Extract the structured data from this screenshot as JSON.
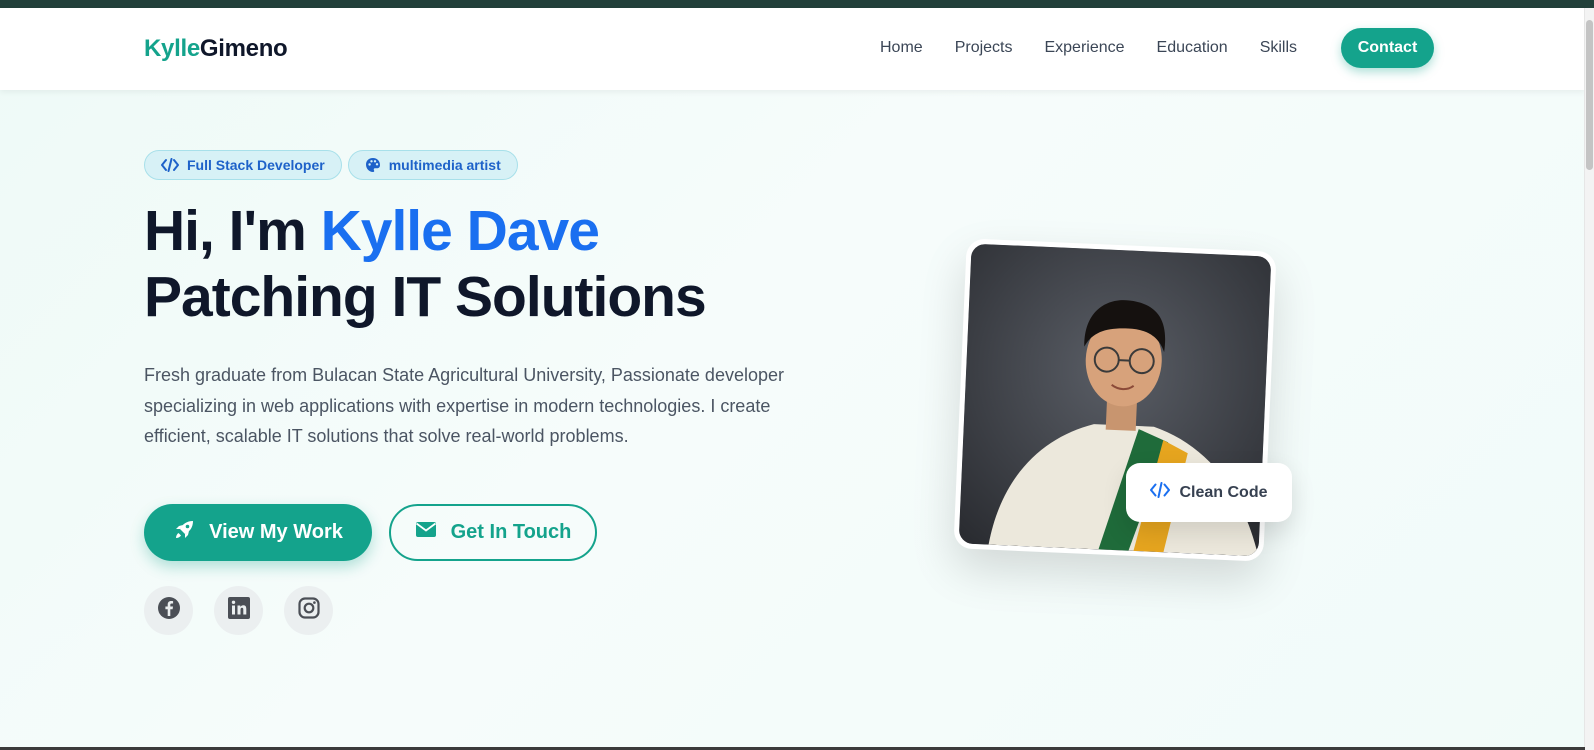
{
  "brand": {
    "first": "Kylle",
    "last": "Gimeno"
  },
  "nav": {
    "links": [
      "Home",
      "Projects",
      "Experience",
      "Education",
      "Skills"
    ],
    "contact_label": "Contact"
  },
  "hero": {
    "badges": [
      {
        "label": "Full Stack Developer",
        "icon": "code-icon"
      },
      {
        "label": "multimedia artist",
        "icon": "palette-icon"
      }
    ],
    "greeting": "Hi, I'm ",
    "name": "Kylle Dave",
    "title_line2": "Patching IT Solutions",
    "description": "Fresh graduate from Bulacan State Agricultural University, Passionate developer specializing in web applications with expertise in modern technologies. I create efficient, scalable IT solutions that solve real-world problems.",
    "primary_button": {
      "label": "View My Work",
      "icon": "rocket-icon"
    },
    "secondary_button": {
      "label": "Get In Touch",
      "icon": "envelope-icon"
    },
    "socials": [
      "facebook-icon",
      "linkedin-icon",
      "instagram-icon"
    ],
    "photo_card_label": "Clean Code"
  },
  "colors": {
    "accent": "#14a38c",
    "highlight": "#1a6ff0",
    "heading": "#0f172a",
    "text": "#4b5563"
  }
}
